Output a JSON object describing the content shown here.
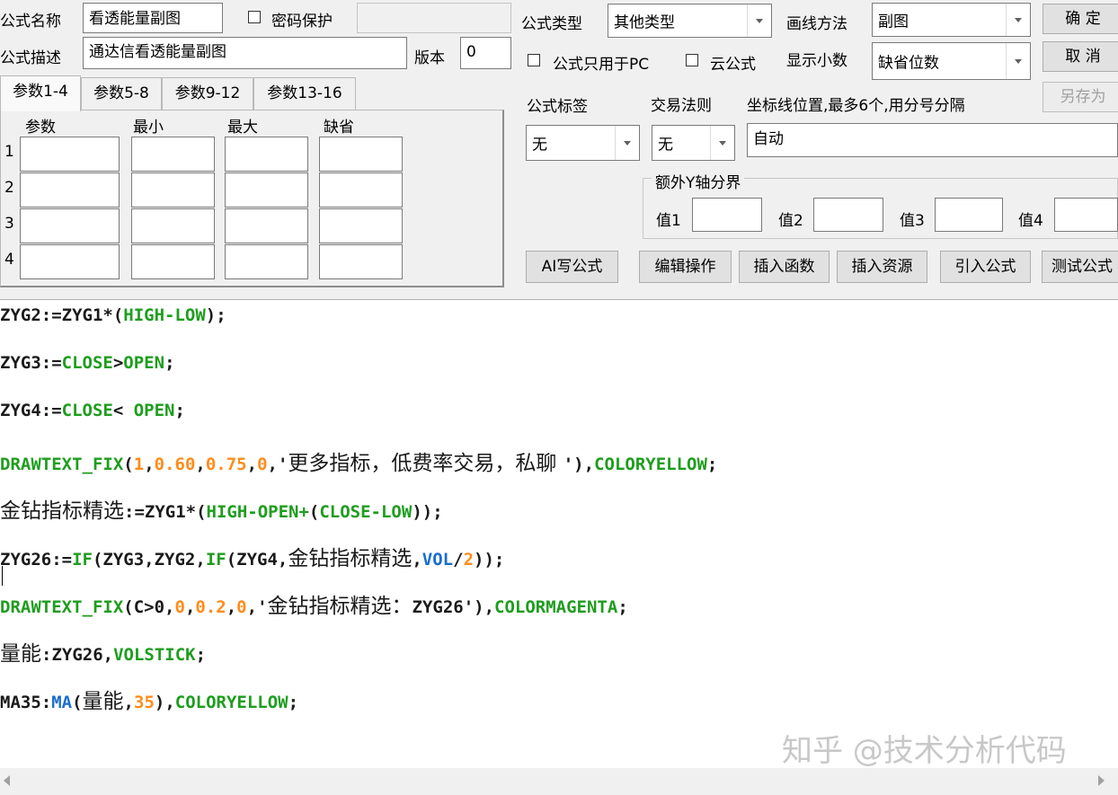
{
  "form": {
    "name_label": "公式名称",
    "name_value": "看透能量副图",
    "password_label": "密码保护",
    "desc_label": "公式描述",
    "desc_value": "通达信看透能量副图",
    "version_label": "版本",
    "version_value": "0",
    "type_label": "公式类型",
    "type_value": "其他类型",
    "draw_label": "画线方法",
    "draw_value": "副图",
    "pc_only_label": "公式只用于PC",
    "cloud_label": "云公式",
    "decimals_label": "显示小数",
    "decimals_value": "缺省位数",
    "tag_label": "公式标签",
    "tag_value": "无",
    "trade_label": "交易法则",
    "trade_value": "无",
    "coord_label": "坐标线位置,最多6个,用分号分隔",
    "coord_value": "自动",
    "yaxis_group": "额外Y轴分界",
    "v1": "值1",
    "v2": "值2",
    "v3": "值3",
    "v4": "值4"
  },
  "buttons": {
    "ok": "确 定",
    "cancel": "取 消",
    "saveas": "另存为",
    "ai": "AI写公式",
    "edit": "编辑操作",
    "insert_fn": "插入函数",
    "insert_res": "插入资源",
    "import": "引入公式",
    "test": "测试公式"
  },
  "tabs": [
    "参数1-4",
    "参数5-8",
    "参数9-12",
    "参数13-16"
  ],
  "param_headers": [
    "参数",
    "最小",
    "最大",
    "缺省"
  ],
  "param_rows": [
    "1",
    "2",
    "3",
    "4"
  ],
  "watermark": "知乎 @技术分析代码",
  "code": {
    "l1": {
      "a": "ZYG2:=ZYG1*(",
      "b": "HIGH-LOW",
      "c": ");"
    },
    "l2": {
      "a": "ZYG3:=",
      "b": "CLOSE",
      "c": ">",
      "d": "OPEN",
      "e": ";"
    },
    "l3": {
      "a": "ZYG4:=",
      "b": "CLOSE",
      "c": "< ",
      "d": "OPEN",
      "e": ";"
    },
    "l4": {
      "a": "DRAWTEXT_FIX",
      "b": "(",
      "c": "1",
      "d": ",",
      "e": "0.60",
      "f": ",",
      "g": "0.75",
      "h": ",",
      "i": "0",
      "j": ",'",
      "k": "更多指标，低费率交易，私聊 ",
      "l": "'),",
      "m": "COLORYELLOW",
      "n": ";"
    },
    "l5": {
      "a": "金钻指标精选",
      "b": ":=ZYG1*(",
      "c": "HIGH-OPEN+",
      "d": "(",
      "e": "CLOSE-LOW",
      "f": "));"
    },
    "l6": {
      "a": "ZYG26:=",
      "b": "IF",
      "c": "(ZYG3,ZYG2,",
      "d": "IF",
      "e": "(ZYG4,",
      "f": "金钻指标精选",
      "g": ",",
      "h": "VOL",
      "i": "/",
      "j": "2",
      "k": "));"
    },
    "l7": {
      "a": "DRAWTEXT_FIX",
      "b": "(C>0,",
      "c": "0",
      "d": ",",
      "e": "0.2",
      "f": ",",
      "g": "0",
      "h": ",'",
      "i": "金钻指标精选：",
      "j": "ZYG26",
      "k": "'),",
      "l": "COLORMAGENTA",
      "m": ";"
    },
    "l8": {
      "a": "量能",
      "b": ":ZYG26,",
      "c": "VOLSTICK",
      "d": ";"
    },
    "l9": {
      "a": "MA35:",
      "b": "MA",
      "c": "(",
      "d": "量能",
      "e": ",",
      "f": "35",
      "g": "),",
      "h": "COLORYELLOW",
      "i": ";"
    }
  }
}
